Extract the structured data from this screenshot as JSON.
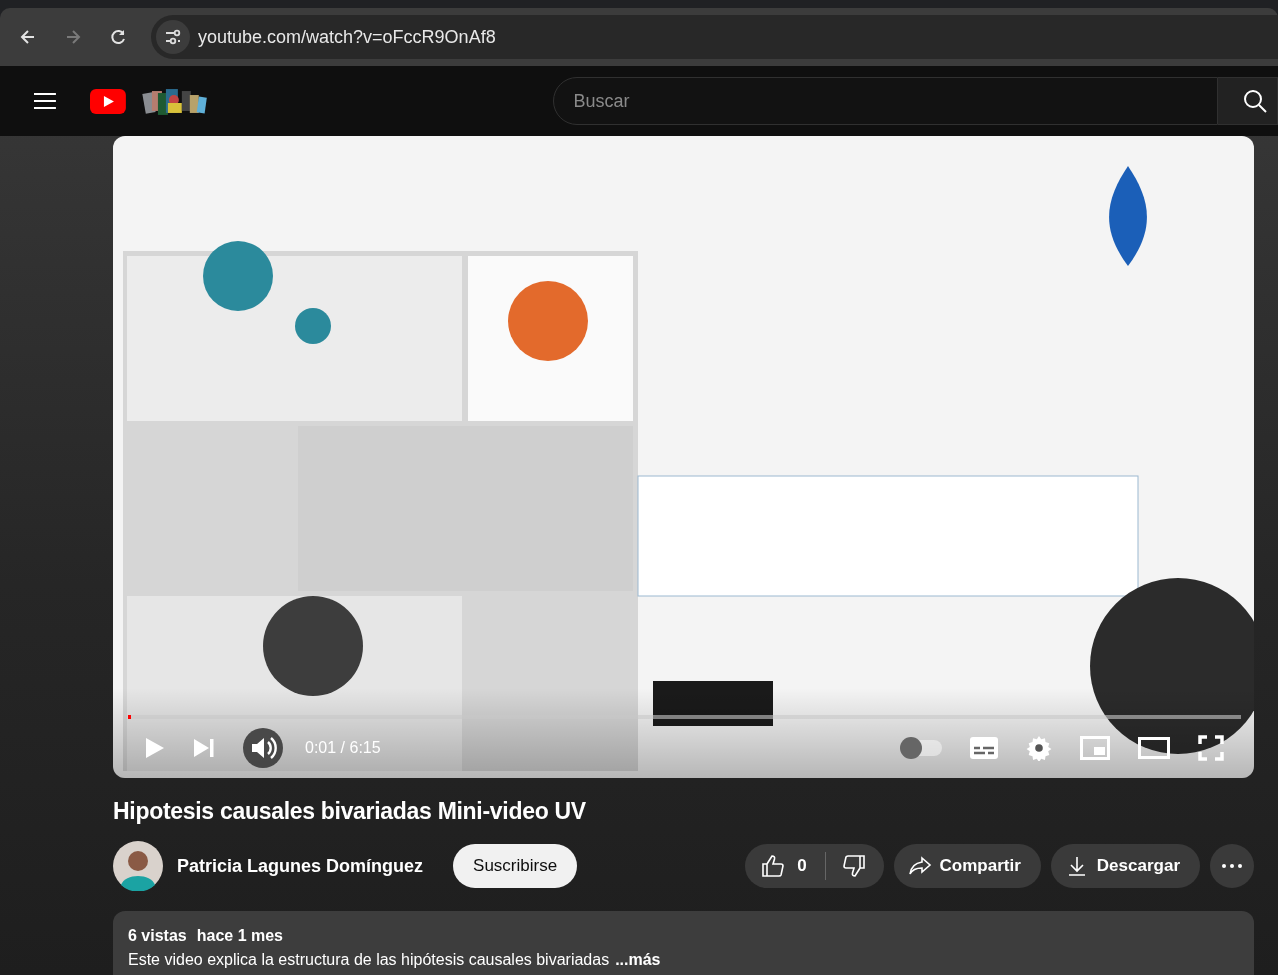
{
  "browser": {
    "url": "youtube.com/watch?v=oFccR9OnAf8"
  },
  "header": {
    "search": {
      "placeholder": "Buscar"
    }
  },
  "player": {
    "progress": {
      "level": 0.003
    },
    "time": "0:01 / 6:15",
    "autoplay": {
      "on": false
    }
  },
  "video": {
    "title": "Hipotesis causales bivariadas Mini-video UV"
  },
  "channel": {
    "name": "Patricia Lagunes Domínguez",
    "subscribe": "Suscribirse"
  },
  "actions": {
    "likes": "0",
    "share": "Compartir",
    "download": "Descargar"
  },
  "description": {
    "views": "6 vistas",
    "date": "hace 1 mes",
    "text": "Este video explica la estructura de las hipótesis causales bivariadas",
    "more": "...más"
  }
}
